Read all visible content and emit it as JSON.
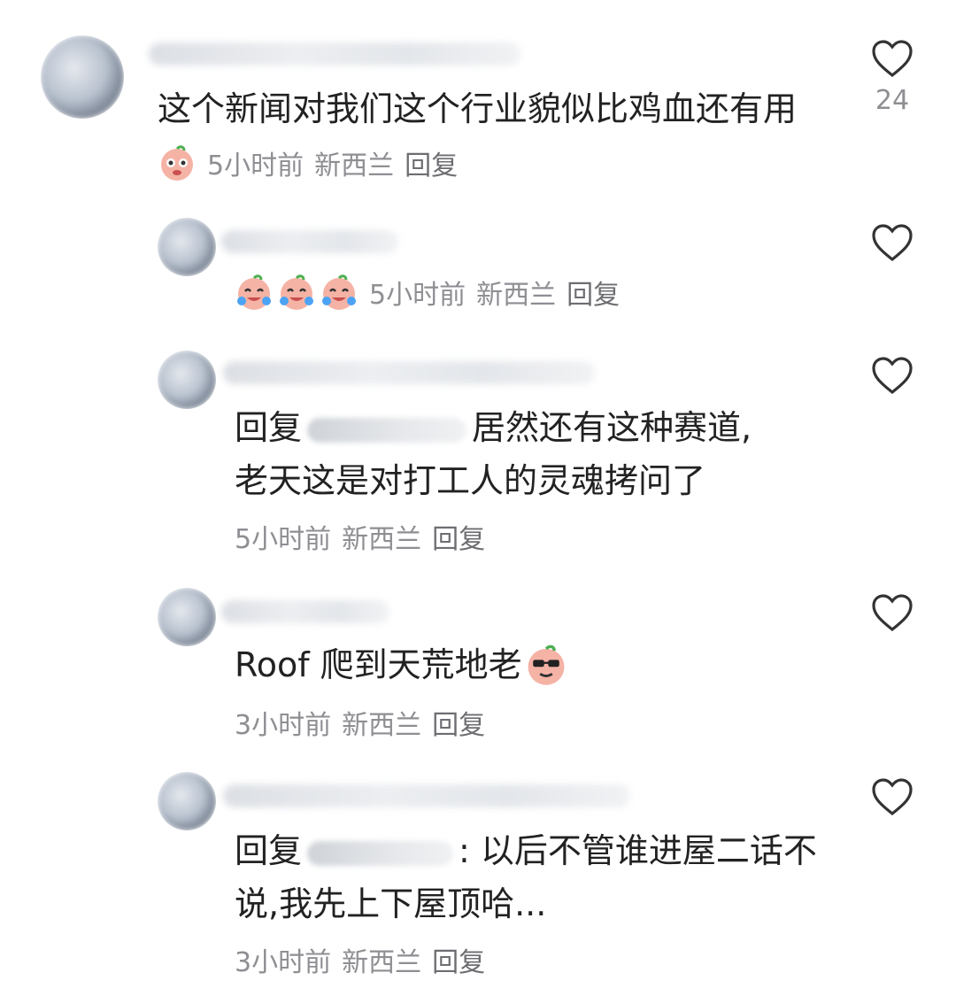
{
  "comments": [
    {
      "text": "这个新闻对我们这个行业貌似比鸡血还有用",
      "time": "5小时前",
      "location": "新西兰",
      "reply": "回复",
      "likes": "24"
    },
    {
      "time": "5小时前",
      "location": "新西兰",
      "reply": "回复"
    },
    {
      "prefix": "回复",
      "text_a": "居然还有这种赛道,",
      "text_b": "老天这是对打工人的灵魂拷问了",
      "time": "5小时前",
      "location": "新西兰",
      "reply": "回复"
    },
    {
      "text": "Roof 爬到天荒地老",
      "time": "3小时前",
      "location": "新西兰",
      "reply": "回复"
    },
    {
      "prefix": "回复",
      "text_a": ": 以后不管谁进屋二话不",
      "text_b": "说,我先上下屋顶哈...",
      "time": "3小时前",
      "location": "新西兰",
      "reply": "回复"
    }
  ],
  "icons": {
    "like": "heart-outline-icon",
    "emoji": "peach-face-emoji"
  },
  "colors": {
    "text": "#222222",
    "meta": "#8e8e93",
    "emoji": "#f3a99b"
  }
}
